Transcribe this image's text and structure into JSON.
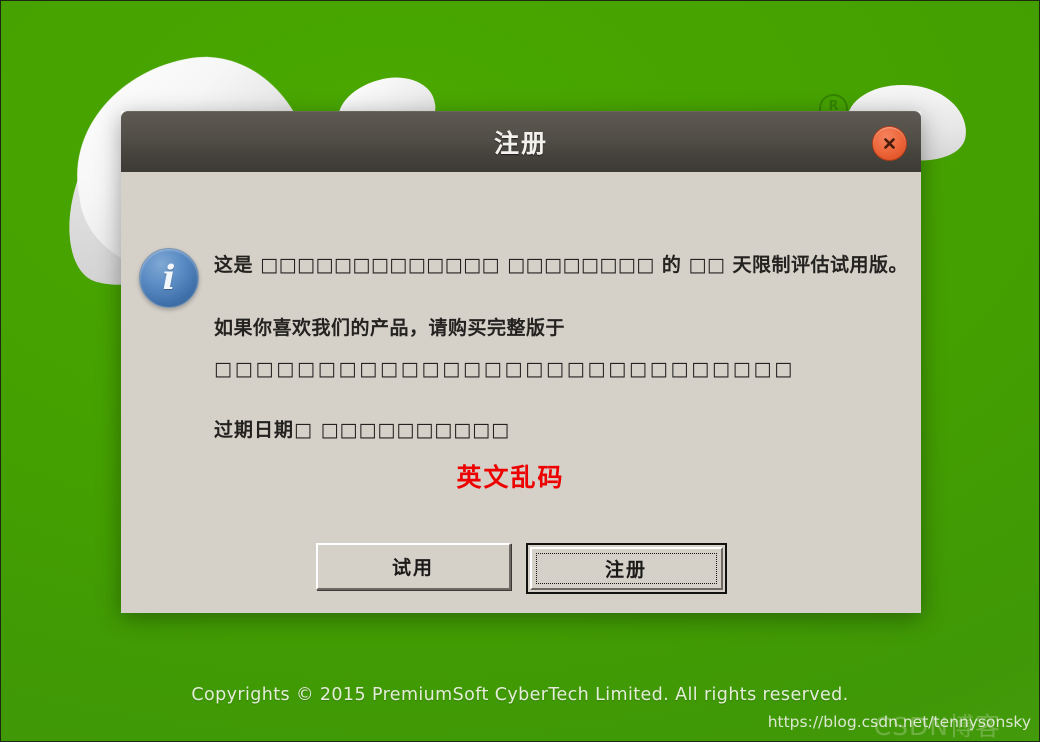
{
  "window": {
    "title": "注册",
    "close_icon": "close-x-icon"
  },
  "dialog": {
    "icon": "info-icon",
    "icon_glyph": "i",
    "paragraph_1": "这是 □□□□□□□□□□□□□ □□□□□□□□ 的 □□ 天限制评估试用版。",
    "paragraph_2": "如果你喜欢我们的产品，请购买完整版于",
    "paragraph_3": "□□□□□□□□□□□□□□□□□□□□□□□□□□□□",
    "paragraph_4": "过期日期□ □□□□□□□□□□",
    "annotation_red": "英文乱码",
    "annotation_color": "#ee0000"
  },
  "buttons": {
    "trial_label": "试用",
    "register_label": "注册"
  },
  "footer": {
    "copyright": "Copyrights © 2015 PremiumSoft CyberTech Limited. All rights reserved.",
    "watermark": "https://blog.csdn.net/tennysonsky",
    "watermark_ghost": "CSDN博客"
  },
  "background": {
    "trademark_symbol": "R",
    "color_primary": "#44a000",
    "color_secondary": "#4a9c14",
    "dialog_body_color": "#d5d1c9",
    "titlebar_color": "#514d47"
  }
}
